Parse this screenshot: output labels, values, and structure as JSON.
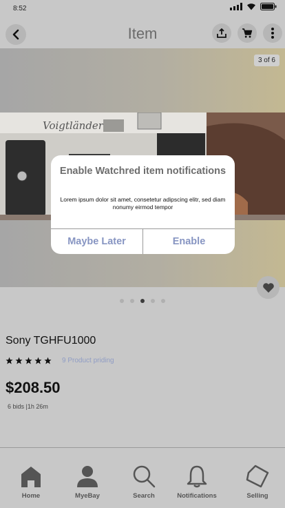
{
  "status": {
    "time": "8:52"
  },
  "header": {
    "title": "Item"
  },
  "gallery": {
    "counter": "3 of 6",
    "brand_text": "Voigtländer",
    "dots_total": 5,
    "dots_active_index": 2
  },
  "product": {
    "title": "Sony TGHFU1000",
    "rating_stars": 5,
    "reviews_link": "9 Product priding",
    "price": "$208.50",
    "bids": "6 bids |1h 26m"
  },
  "modal": {
    "title": "Enable Watchred item notifications",
    "message": "Lorem ipsum dolor sit amet, consetetur adipscing elitr, sed diam nonumy eirmod tempor",
    "maybe_later": "Maybe Later",
    "enable": "Enable"
  },
  "tabbar": {
    "home": "Home",
    "myebay": "MyeBay",
    "search": "Search",
    "notifications": "Notifications",
    "selling": "Selling"
  },
  "colors": {
    "link": "#8f9cc4",
    "modal_button": "#8795c2",
    "background": "#c8c8c8"
  }
}
